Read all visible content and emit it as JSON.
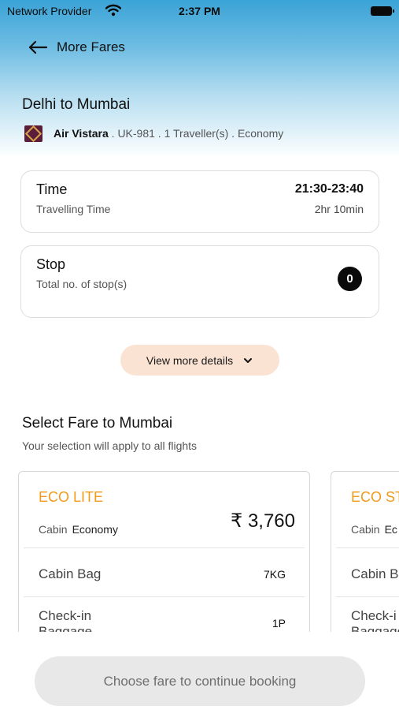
{
  "status_bar": {
    "carrier": "Network Provider",
    "time": "2:37 PM"
  },
  "header": {
    "title": "More Fares"
  },
  "flight": {
    "route": "Delhi to Mumbai",
    "airline": "Air Vistara",
    "details": " . UK-981 . 1 Traveller(s) . Economy"
  },
  "time_card": {
    "label": "Time",
    "sublabel": "Travelling Time",
    "time_range": "21:30-23:40",
    "duration": "2hr 10min"
  },
  "stop_card": {
    "label": "Stop",
    "sublabel": "Total no. of stop(s)",
    "count": "0"
  },
  "details_button": {
    "label": "View more details"
  },
  "fare_section": {
    "title": "Select Fare to Mumbai",
    "subtitle": "Your selection will apply to all flights"
  },
  "fares": [
    {
      "name": "ECO LITE",
      "cabin_label": "Cabin",
      "cabin_value": "Economy",
      "price": "₹ 3,760",
      "cabin_bag_label": "Cabin Bag",
      "cabin_bag_value": "7KG",
      "checkin_label": "Check-in Baggage",
      "checkin_value": "1P"
    },
    {
      "name": "ECO ST",
      "cabin_label": "Cabin",
      "cabin_value": "Ec",
      "cabin_bag_label": "Cabin B",
      "checkin_label": "Check-i Baggage"
    }
  ],
  "cta": {
    "label": "Choose fare to continue booking"
  },
  "colors": {
    "accent_orange": "#f29a1a",
    "header_gradient_top": "#3aa3d6",
    "details_button_bg": "#fbe3d4",
    "cta_bg": "#e8e8e8"
  }
}
